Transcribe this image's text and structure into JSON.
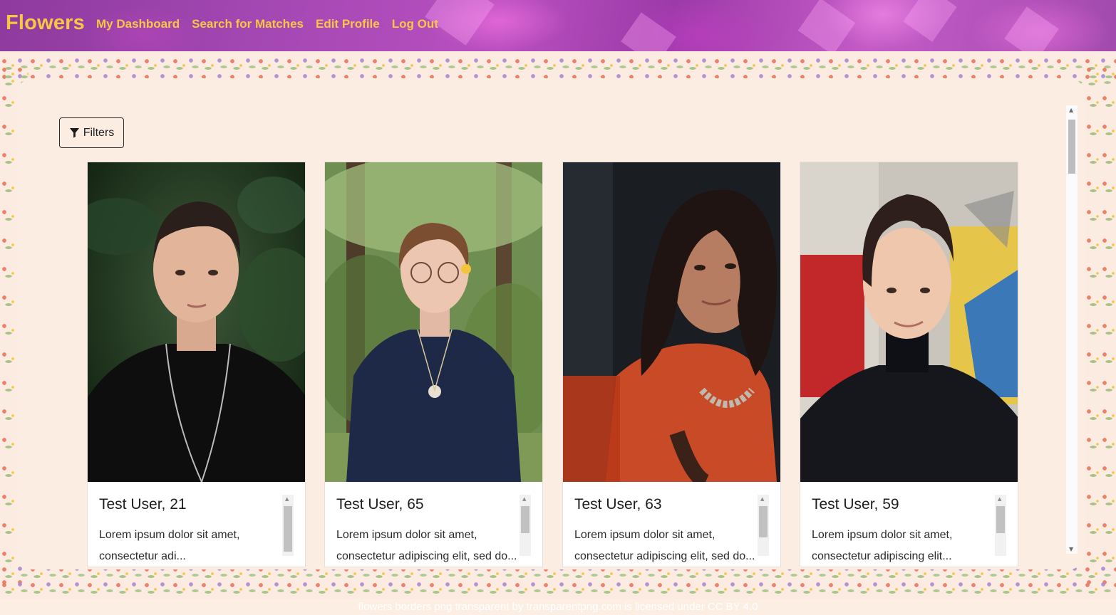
{
  "navbar": {
    "brand": "Flowers",
    "links": [
      {
        "label": "My Dashboard"
      },
      {
        "label": "Search for Matches"
      },
      {
        "label": "Edit Profile"
      },
      {
        "label": "Log Out"
      }
    ],
    "colors": {
      "brand": "#f7c744",
      "background": "#a548b4"
    }
  },
  "filters": {
    "label": "Filters",
    "icon": "filter-funnel-icon"
  },
  "cards": [
    {
      "title": "Test User, 21",
      "text": "Lorem ipsum dolor sit amet, consectetur adi...",
      "photo": "portrait-short-dark-hair-black-shirt"
    },
    {
      "title": "Test User, 65",
      "text": "Lorem ipsum dolor sit amet, consectetur adipiscing elit, sed do...",
      "photo": "portrait-glasses-navy-shirt-forest"
    },
    {
      "title": "Test User, 63",
      "text": "Lorem ipsum dolor sit amet, consectetur adipiscing elit, sed do...",
      "photo": "portrait-long-dark-hair-orange-top"
    },
    {
      "title": "Test User, 59",
      "text": "Lorem ipsum dolor sit amet, consectetur adipiscing elit...",
      "photo": "portrait-short-hair-black-jacket-mural"
    }
  ],
  "footer": {
    "credit": "flowers borders png transparent by transparentpng.com is licensed under CC BY 4.0"
  }
}
